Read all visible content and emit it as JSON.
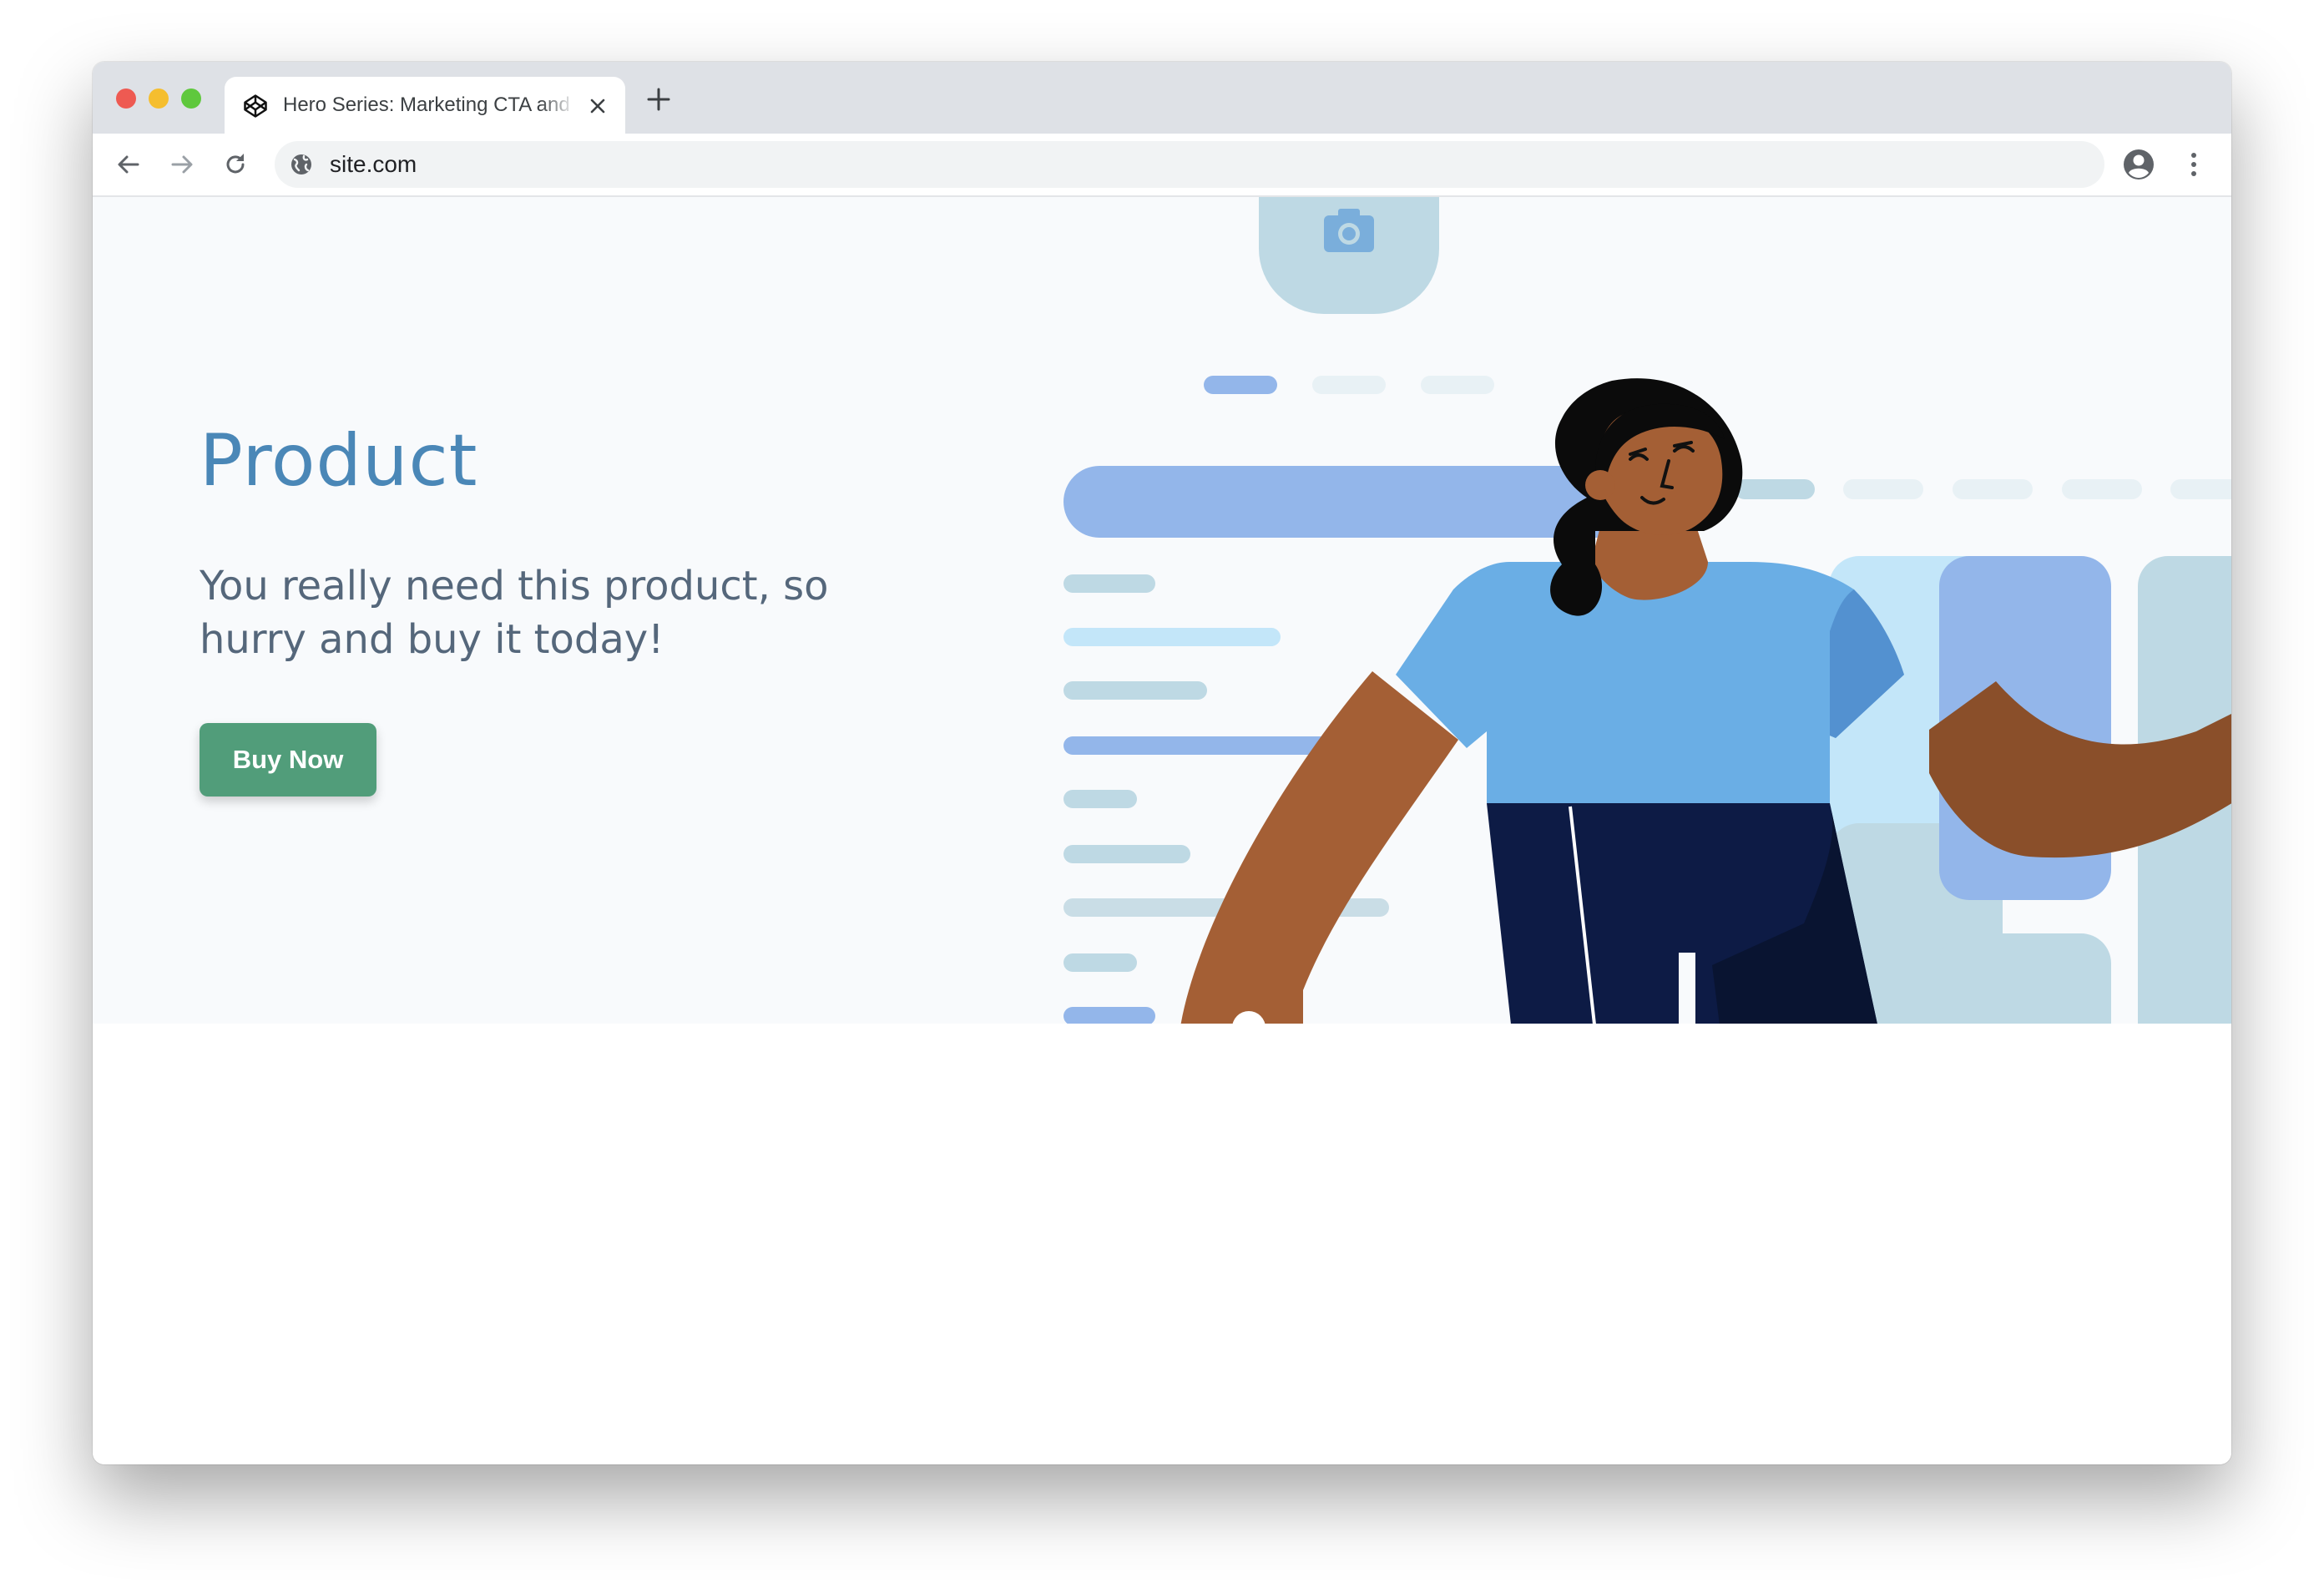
{
  "browser": {
    "tab_title": "Hero Series: Marketing CTA and",
    "address": "site.com"
  },
  "hero": {
    "title": "Product",
    "subtitle": "You really need this product, so hurry and buy it today!",
    "cta_label": "Buy Now"
  },
  "colors": {
    "title": "#4a87b7",
    "subtitle": "#55677b",
    "cta_background": "#519d7a",
    "hero_background": "#f8fafc",
    "accent_blue": "#93b6ea",
    "light_blue": "#bed9e4",
    "shirt": "#6aaee5",
    "skin": "#a45f35",
    "pants": "#0d1b45"
  },
  "icons": {
    "tab": "codepen-icon",
    "close": "close-icon",
    "new_tab": "plus-icon",
    "back": "arrow-left-icon",
    "forward": "arrow-right-icon",
    "reload": "reload-icon",
    "site": "globe-icon",
    "profile": "account-circle-icon",
    "menu": "more-vertical-icon",
    "illustration": "camera-icon"
  }
}
